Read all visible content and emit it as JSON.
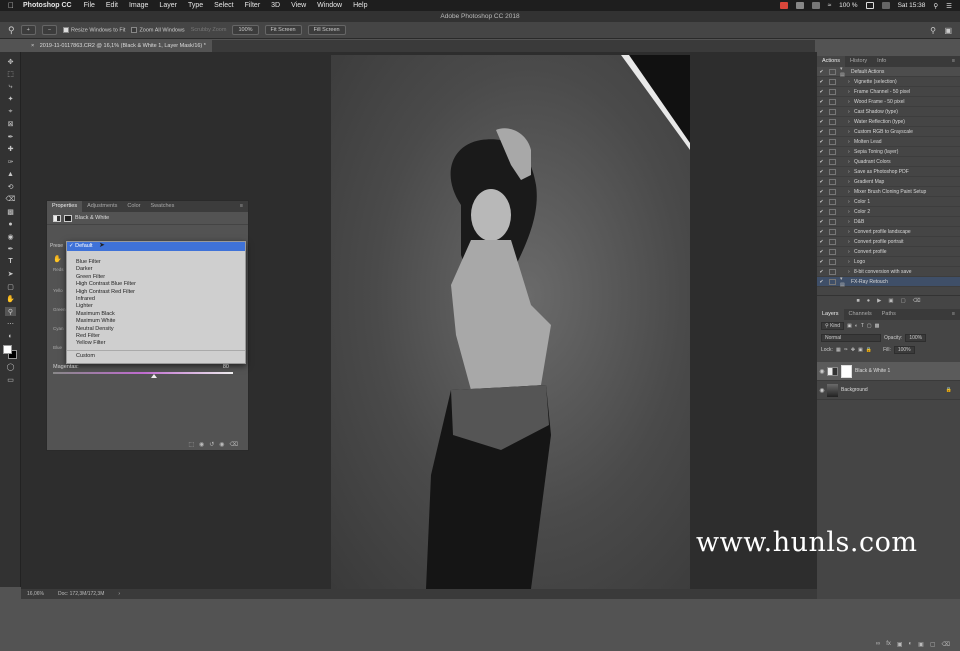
{
  "menubar": {
    "app_name": "Photoshop CC",
    "items": [
      "File",
      "Edit",
      "Image",
      "Layer",
      "Type",
      "Select",
      "Filter",
      "3D",
      "View",
      "Window",
      "Help"
    ],
    "battery": "100 %",
    "clock": "Sat 15:38"
  },
  "window_title": "Adobe Photoshop CC 2018",
  "options_bar": {
    "resize_windows": "Resize Windows to Fit",
    "zoom_all": "Zoom All Windows",
    "scrubby_zoom": "Scrubby Zoom",
    "zoom_value": "100%",
    "fit_screen": "Fit Screen",
    "fill_screen": "Fill Screen"
  },
  "document_tab": "2019-11-0117863.CR2 @ 16,1% (Black & White 1, Layer Mask/16) *",
  "properties": {
    "tabs": [
      "Properties",
      "Adjustments",
      "Color",
      "Swatches"
    ],
    "adjustment_name": "Black & White",
    "preset_label": "Prese",
    "preset_selected": "Default",
    "preset_options": [
      "Blue Filter",
      "Darker",
      "Green Filter",
      "High Contrast Blue Filter",
      "High Contrast Red Filter",
      "Infrared",
      "Lighter",
      "Maximum Black",
      "Maximum White",
      "Neutral Density",
      "Red Filter",
      "Yellow Filter"
    ],
    "preset_custom": "Custom",
    "sliders_hidden_labels": [
      "Reds",
      "Yello",
      "Green",
      "Cyan",
      "Blue"
    ],
    "magentas_label": "Magentas:",
    "magentas_value": "80",
    "magentas_level": 0.56
  },
  "actions_panel": {
    "tabs": [
      "Actions",
      "History",
      "Info"
    ],
    "items": [
      {
        "label": "Default Actions",
        "type": "folder"
      },
      {
        "label": "Vignette (selection)",
        "type": "action"
      },
      {
        "label": "Frame Channel - 50 pixel",
        "type": "action"
      },
      {
        "label": "Wood Frame - 50 pixel",
        "type": "action"
      },
      {
        "label": "Cast Shadow (type)",
        "type": "action"
      },
      {
        "label": "Water Reflection (type)",
        "type": "action"
      },
      {
        "label": "Custom RGB to Grayscale",
        "type": "action"
      },
      {
        "label": "Molten Lead",
        "type": "action"
      },
      {
        "label": "Sepia Toning (layer)",
        "type": "action"
      },
      {
        "label": "Quadrant Colors",
        "type": "action"
      },
      {
        "label": "Save as Photoshop PDF",
        "type": "action"
      },
      {
        "label": "Gradient Map",
        "type": "action"
      },
      {
        "label": "Mixer Brush Cloning Paint Setup",
        "type": "action"
      },
      {
        "label": "Color 1",
        "type": "action"
      },
      {
        "label": "Color 2",
        "type": "action"
      },
      {
        "label": "D&B",
        "type": "action"
      },
      {
        "label": "Convert profile landscape",
        "type": "action"
      },
      {
        "label": "Convert profile portrait",
        "type": "action"
      },
      {
        "label": "Convert profile",
        "type": "action"
      },
      {
        "label": "Logo",
        "type": "action"
      },
      {
        "label": "8-bit conversion with save",
        "type": "action"
      },
      {
        "label": "FX-Ray Retouch",
        "type": "folder-fx"
      }
    ]
  },
  "layers_panel": {
    "tabs": [
      "Layers",
      "Channels",
      "Paths"
    ],
    "kind": "Kind",
    "blend_mode": "Normal",
    "opacity_label": "Opacity:",
    "opacity_value": "100%",
    "lock_label": "Lock:",
    "fill_label": "Fill:",
    "fill_value": "100%",
    "layers": [
      {
        "name": "Black & White 1",
        "selected": true
      },
      {
        "name": "Background",
        "selected": false
      }
    ]
  },
  "status_bar": {
    "zoom": "16,06%",
    "doc": "Doc: 172,3M/172,3M"
  },
  "watermark": "www.hunls.com",
  "colors": {
    "menu_bg": "#1e1e1e",
    "panel_bg": "#535353",
    "selection_blue": "#3f72d8",
    "magenta_track": "#c06bd0"
  }
}
